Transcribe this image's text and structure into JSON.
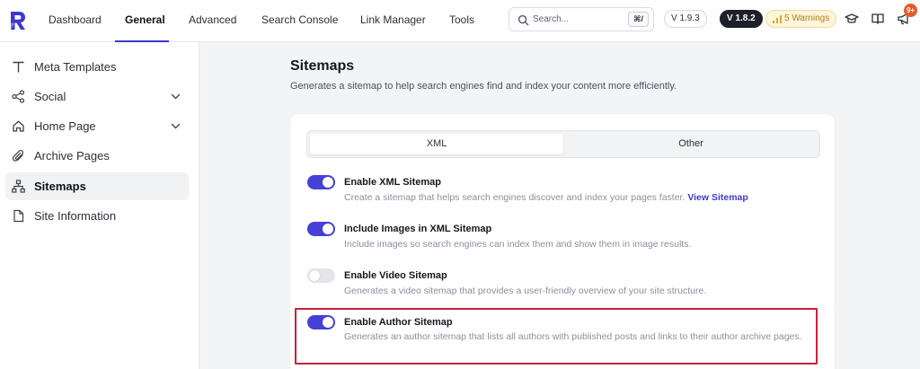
{
  "nav": {
    "items": [
      "Dashboard",
      "General",
      "Advanced",
      "Search Console",
      "Link Manager",
      "Tools"
    ],
    "active": "General"
  },
  "search": {
    "placeholder": "Search...",
    "shortcut": "⌘/"
  },
  "versions": {
    "current": "V 1.9.3",
    "pro": "V 1.8.2"
  },
  "warnings": {
    "label": "5 Warnings"
  },
  "notifications": {
    "count": "9+"
  },
  "sidebar": {
    "items": [
      {
        "label": "Meta Templates",
        "icon": "text-t-icon"
      },
      {
        "label": "Social",
        "icon": "share-icon",
        "has_children": true
      },
      {
        "label": "Home Page",
        "icon": "home-icon",
        "has_children": true
      },
      {
        "label": "Archive Pages",
        "icon": "paperclip-icon"
      },
      {
        "label": "Sitemaps",
        "icon": "sitemap-icon",
        "active": true
      },
      {
        "label": "Site Information",
        "icon": "document-icon"
      }
    ]
  },
  "main": {
    "title": "Sitemaps",
    "description": "Generates a sitemap to help search engines find and index your content more efficiently.",
    "tabs": [
      "XML",
      "Other"
    ],
    "active_tab": "XML",
    "options": [
      {
        "title": "Enable XML Sitemap",
        "description": "Create a sitemap that helps search engines discover and index your pages faster.",
        "link": "View Sitemap",
        "enabled": true
      },
      {
        "title": "Include Images in XML Sitemap",
        "description": "Include images so search engines can index them and show them in image results.",
        "enabled": true
      },
      {
        "title": "Enable Video Sitemap",
        "description": "Generates a video sitemap that provides a user-friendly overview of your site structure.",
        "enabled": false
      },
      {
        "title": "Enable Author Sitemap",
        "description": "Generates an author sitemap that lists all authors with published posts and links to their author archive pages.",
        "enabled": true
      }
    ]
  },
  "colors": {
    "accent": "#4540d6",
    "highlight": "#c8203e",
    "warning": "#b97d0f",
    "badge": "#e8592a"
  }
}
